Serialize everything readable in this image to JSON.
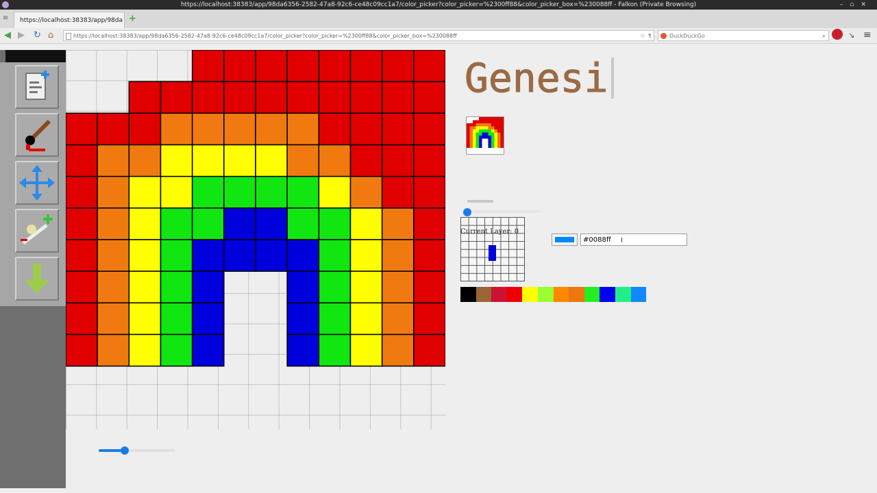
{
  "browser": {
    "window_title": "https://localhost:38383/app/98da6356-2582-47a8-92c6-ce48c09cc1a7/color_picker?color_picker=%2300ff88&color_picker_box=%230088ff - Falkon (Private Browsing)",
    "tab_title": "https://localhost:38383/app/98da",
    "url": "https://localhost:38383/app/98da6356-2582-47a8-92c6-ce48c09cc1a7/color_picker?color_picker=%2300ff88&color_picker_box=%230088ff",
    "search_placeholder": "DuckDuckGo"
  },
  "app": {
    "logo_text": "Genesis",
    "tools": [
      {
        "name": "new-file"
      },
      {
        "name": "paint-brush"
      },
      {
        "name": "move-arrows"
      },
      {
        "name": "add-layer"
      },
      {
        "name": "download"
      }
    ],
    "layer": {
      "label": "Current Layer: 0",
      "slider_level": 0
    },
    "zoom_level": 0.34,
    "color": {
      "picker_value": "#0088ff",
      "swatch_color": "#0088ff"
    },
    "palette": [
      "#000000",
      "#996633",
      "#cc1133",
      "#ee0000",
      "#ffff00",
      "#99ff33",
      "#ff8800",
      "#ee7711",
      "#22ee22",
      "#0000ee",
      "#22ee88",
      "#1188ff"
    ],
    "grid": {
      "columns": 12,
      "rows": 12,
      "colors": {
        "R": "#e00000",
        "O": "#f07a10",
        "Y": "#ffff00",
        "G": "#11e611",
        "B": "#0000dd"
      },
      "pixels": [
        "....RRRRRRRR",
        "..RRRRRRRRRR",
        "RRROOOOORRRR",
        "ROOYYYYOORRR",
        "ROYYGGGGYORR",
        "ROYGGBBGGYOR",
        "ROYGBBBBGYOR",
        "ROYGB..BGYOR",
        "ROYGB..BGYOR",
        "ROYGB..BGYOR",
        "............",
        "............"
      ]
    }
  }
}
